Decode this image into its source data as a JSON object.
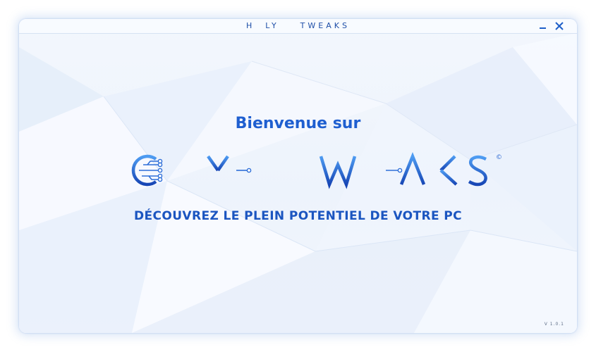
{
  "window": {
    "title": "HOLY TWEAKS",
    "title_display": "H  LY    TWEAKS",
    "minimize_icon": "minimize-icon",
    "close_icon": "close-icon"
  },
  "main": {
    "welcome": "Bienvenue sur",
    "logo_text": "HOLY TWEAKS",
    "logo_mark": "©",
    "tagline": "DÉCOUVREZ LE PLEIN POTENTIEL DE VOTRE PC"
  },
  "footer": {
    "version": "V 1.0.1"
  },
  "colors": {
    "accent": "#1f5fd0",
    "accent_light": "#5aa4f5",
    "background": "#eef4fc"
  }
}
